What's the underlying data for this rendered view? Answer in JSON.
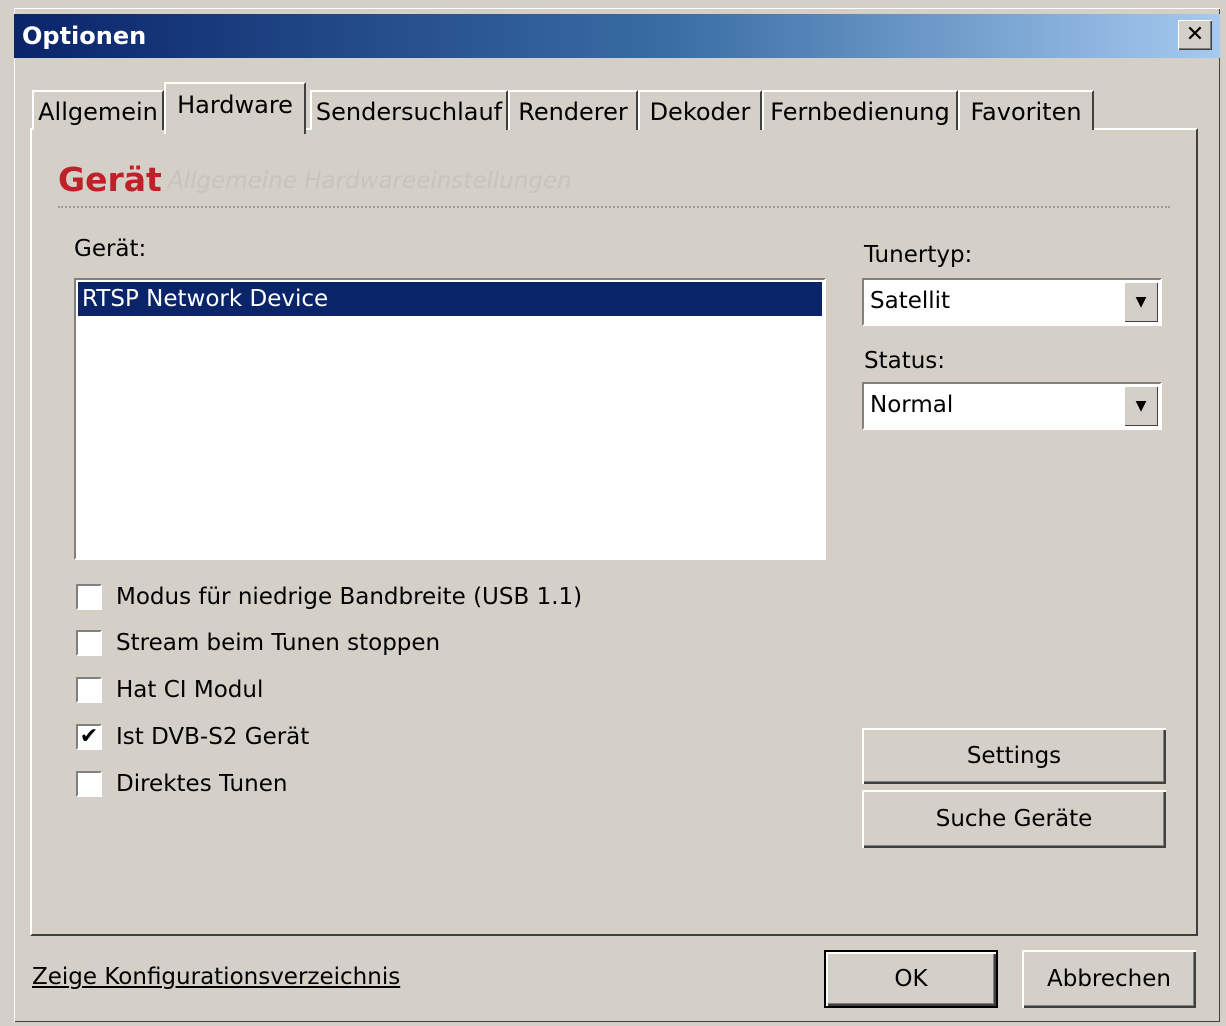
{
  "window": {
    "title": "Optionen",
    "close_glyph": "✕"
  },
  "tabs": [
    {
      "label": "Allgemein"
    },
    {
      "label": "Hardware"
    },
    {
      "label": "Sendersuchlauf"
    },
    {
      "label": "Renderer"
    },
    {
      "label": "Dekoder"
    },
    {
      "label": "Fernbedienung"
    },
    {
      "label": "Favoriten"
    }
  ],
  "active_tab": "Hardware",
  "header": {
    "title": "Gerät",
    "subtitle": "Allgemeine Hardwareeinstellungen"
  },
  "device": {
    "label": "Gerät:",
    "items": [
      "RTSP Network Device"
    ],
    "selected": "RTSP Network Device"
  },
  "tunertyp": {
    "label": "Tunertyp:",
    "value": "Satellit"
  },
  "status": {
    "label": "Status:",
    "value": "Normal"
  },
  "checkboxes": [
    {
      "label": "Modus für niedrige Bandbreite (USB 1.1)",
      "checked": false
    },
    {
      "label": "Stream beim Tunen stoppen",
      "checked": false
    },
    {
      "label": "Hat CI Modul",
      "checked": false
    },
    {
      "label": "Ist DVB-S2 Gerät",
      "checked": true
    },
    {
      "label": "Direktes Tunen",
      "checked": false
    }
  ],
  "buttons": {
    "settings": "Settings",
    "search": "Suche Geräte",
    "ok": "OK",
    "cancel": "Abbrechen"
  },
  "footer_link": "Zeige Konfigurationsverzeichnis",
  "icons": {
    "dropdown_arrow": "▼",
    "check_mark": "✔"
  }
}
